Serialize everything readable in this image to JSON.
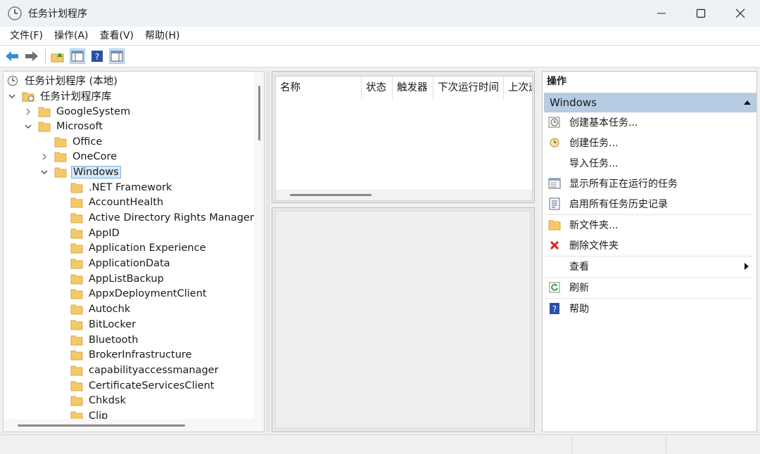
{
  "window": {
    "title": "任务计划程序"
  },
  "menu": [
    "文件(F)",
    "操作(A)",
    "查看(V)",
    "帮助(H)"
  ],
  "toolbar": {
    "icons": [
      "back-arrow-icon",
      "forward-arrow-icon",
      "up-folder-icon",
      "show-hide-console-tree-icon",
      "help-icon",
      "show-hide-action-pane-icon"
    ]
  },
  "tree": {
    "root": "任务计划程序 (本地)",
    "library": "任务计划程序库",
    "google": "GoogleSystem",
    "microsoft": "Microsoft",
    "office": "Office",
    "onecore": "OneCore",
    "windows": "Windows",
    "children": [
      ".NET Framework",
      "AccountHealth",
      "Active Directory Rights Management Services Client",
      "AppID",
      "Application Experience",
      "ApplicationData",
      "AppListBackup",
      "AppxDeploymentClient",
      "Autochk",
      "BitLocker",
      "Bluetooth",
      "BrokerInfrastructure",
      "capabilityaccessmanager",
      "CertificateServicesClient",
      "Chkdsk",
      "Clip"
    ]
  },
  "list": {
    "columns": [
      "名称",
      "状态",
      "触发器",
      "下次运行时间",
      "上次运行时间"
    ]
  },
  "actions": {
    "title": "操作",
    "section": "Windows",
    "items": [
      "创建基本任务...",
      "创建任务...",
      "导入任务...",
      "显示所有正在运行的任务",
      "启用所有任务历史记录",
      "新文件夹...",
      "删除文件夹",
      "查看",
      "刷新",
      "帮助"
    ]
  },
  "colors": {
    "selection": "#d5e8f8",
    "section_header": "#b5cce3",
    "folder": "#f5c96a",
    "delete": "#d9251d"
  }
}
